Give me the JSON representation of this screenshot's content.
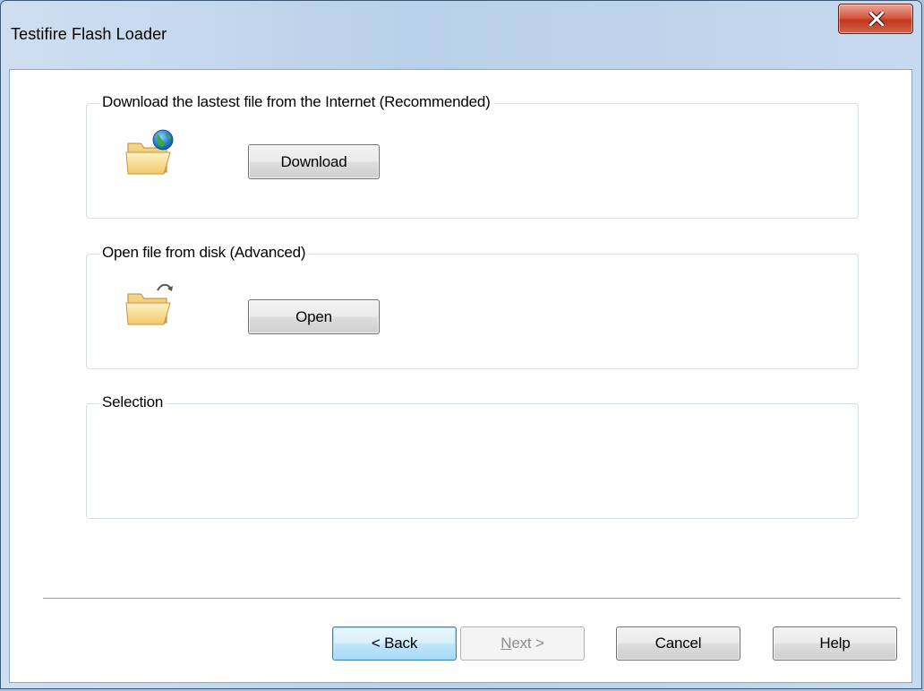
{
  "window": {
    "title": "Testifire Flash Loader",
    "close_label": "x"
  },
  "groups": {
    "download": {
      "label": "Download the lastest file from the Internet  (Recommended)",
      "button_label": "Download",
      "icon": "folder-globe-icon"
    },
    "open": {
      "label": "Open file from disk  (Advanced)",
      "button_label": "Open",
      "icon": "folder-open-arrow-icon"
    },
    "selection": {
      "label": "Selection",
      "value": ""
    }
  },
  "footer": {
    "back_label": "< Back",
    "next_label": "Next >",
    "next_mnemonic": "N",
    "next_rest": "ext >",
    "cancel_label": "Cancel",
    "help_label": "Help"
  },
  "colors": {
    "frame": "#b9d0ea",
    "close_button": "#c2361c",
    "default_button_border": "#3c7fb1"
  }
}
